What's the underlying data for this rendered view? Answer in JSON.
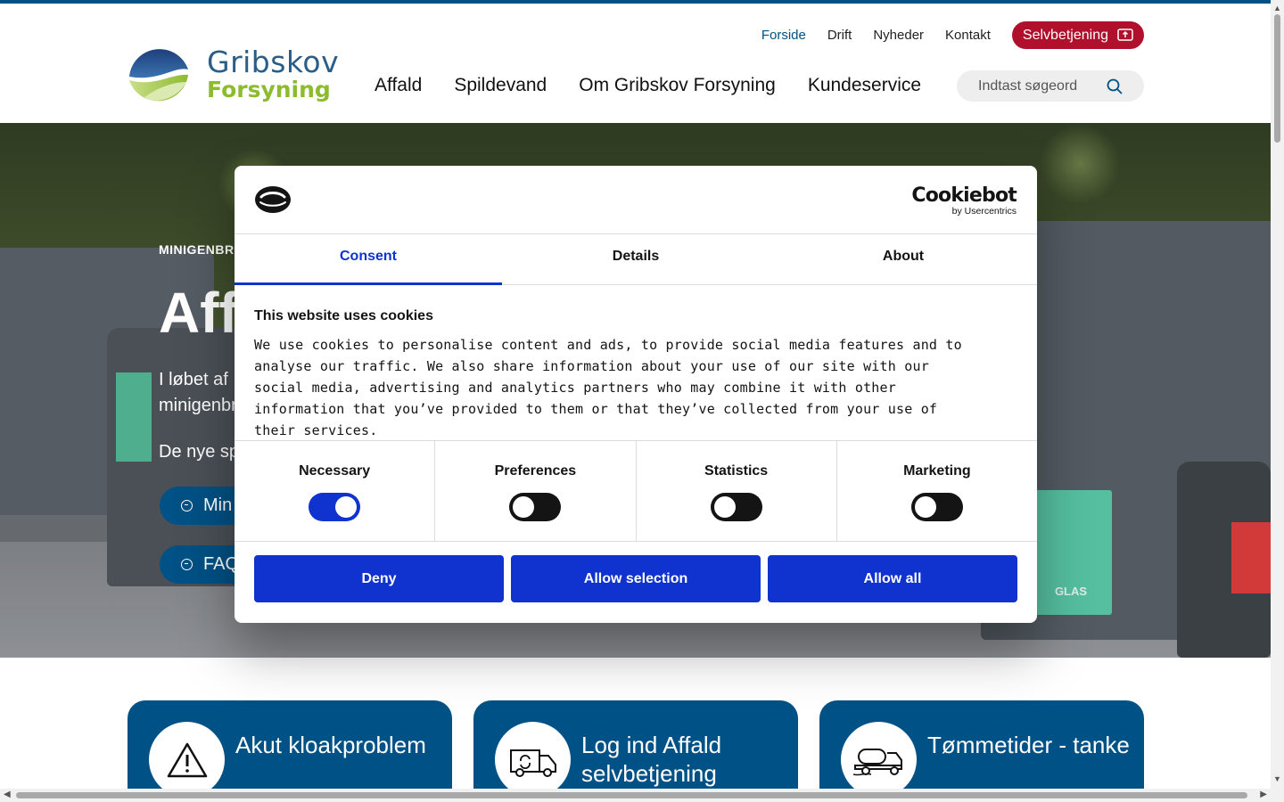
{
  "header": {
    "logo_name": "Gribskov",
    "logo_sub": "Forsyning",
    "util_nav": [
      "Forside",
      "Drift",
      "Nyheder",
      "Kontakt"
    ],
    "self_service_label": "Selvbetjening",
    "main_nav": [
      "Affald",
      "Spildevand",
      "Om Gribskov Forsyning",
      "Kundeservice"
    ],
    "search_placeholder": "Indtast søgeord"
  },
  "hero": {
    "eyebrow": "MINIGENBRU",
    "title": "Aff",
    "text_line1": "I løbet af",
    "text_line2": "minigenbr",
    "text2": "De nye sp",
    "button1": "Min",
    "button2": "FAQ",
    "glas_label": "GLAS"
  },
  "cards": [
    {
      "label": "Akut kloakproblem",
      "icon": "warning-icon"
    },
    {
      "label": "Log ind Affald selvbetjening",
      "icon": "garbage-truck-icon"
    },
    {
      "label": "Tømmetider - tanke",
      "icon": "tank-truck-icon"
    }
  ],
  "cookie_dialog": {
    "brand": "Cookiebot",
    "brand_sub": "by Usercentrics",
    "tabs": [
      "Consent",
      "Details",
      "About"
    ],
    "active_tab": "Consent",
    "heading": "This website uses cookies",
    "body": "We use cookies to personalise content and ads, to provide social media features and to analyse our traffic. We also share information about your use of our site with our social media, advertising and analytics partners who may combine it with other information that you’ve provided to them or that they’ve collected from your use of their services.",
    "categories": [
      {
        "label": "Necessary",
        "enabled": true
      },
      {
        "label": "Preferences",
        "enabled": false
      },
      {
        "label": "Statistics",
        "enabled": false
      },
      {
        "label": "Marketing",
        "enabled": false
      }
    ],
    "buttons": {
      "deny": "Deny",
      "allow_selection": "Allow selection",
      "allow_all": "Allow all"
    },
    "accent_color": "#1032cf"
  },
  "colors": {
    "brand_blue": "#005185",
    "self_service_red": "#b0102c",
    "logo_green": "#8dbb2f"
  }
}
